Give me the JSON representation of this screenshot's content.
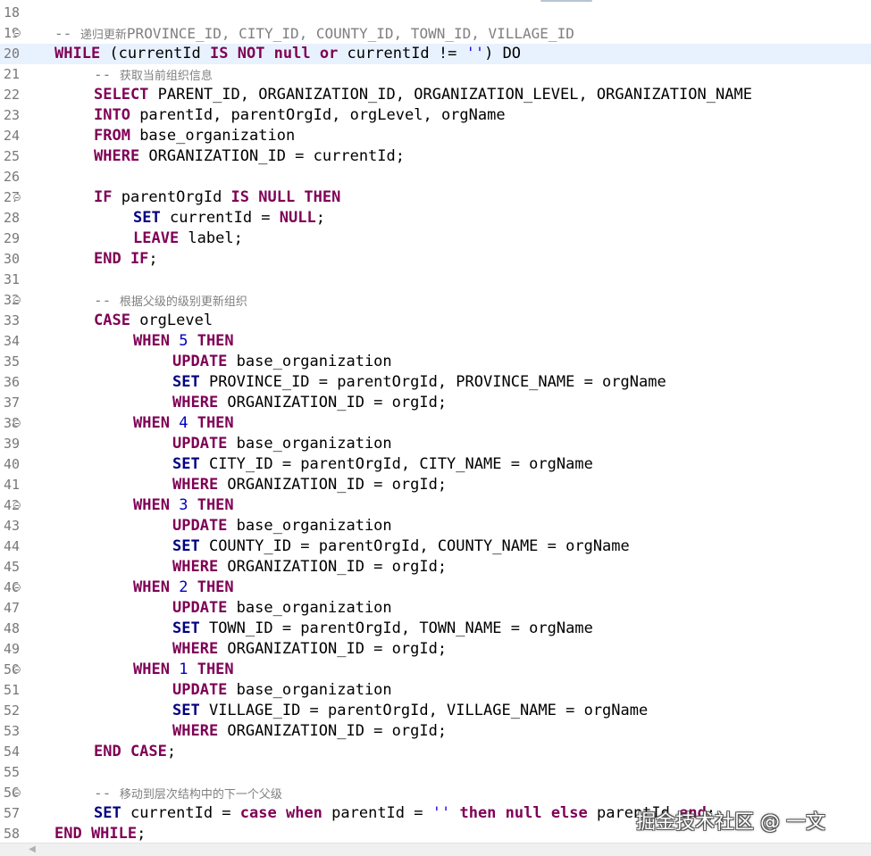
{
  "editor": {
    "current_line": "20",
    "lines": [
      {
        "num": "18",
        "fold": false,
        "indent": 0,
        "tokens": []
      },
      {
        "num": "19",
        "fold": true,
        "indent": 1,
        "tokens": [
          {
            "t": "cmt",
            "v": "-- "
          },
          {
            "t": "cmtcjk",
            "v": "递归更新"
          },
          {
            "t": "cmt",
            "v": "PROVINCE_ID, CITY_ID, COUNTY_ID, TOWN_ID, VILLAGE_ID"
          }
        ]
      },
      {
        "num": "20",
        "fold": false,
        "indent": 1,
        "tokens": [
          {
            "t": "kw",
            "v": "WHILE"
          },
          {
            "t": "txt",
            "v": " (currentId "
          },
          {
            "t": "kw",
            "v": "IS NOT null or"
          },
          {
            "t": "txt",
            "v": " currentId != "
          },
          {
            "t": "str",
            "v": "''"
          },
          {
            "t": "txt",
            "v": ") DO"
          }
        ]
      },
      {
        "num": "21",
        "fold": false,
        "indent": 2,
        "tokens": [
          {
            "t": "cmt",
            "v": "-- "
          },
          {
            "t": "cmtcjk",
            "v": "获取当前组织信息"
          }
        ]
      },
      {
        "num": "22",
        "fold": false,
        "indent": 2,
        "tokens": [
          {
            "t": "kw",
            "v": "SELECT"
          },
          {
            "t": "txt",
            "v": " PARENT_ID, ORGANIZATION_ID, ORGANIZATION_LEVEL, ORGANIZATION_NAME"
          }
        ]
      },
      {
        "num": "23",
        "fold": false,
        "indent": 2,
        "tokens": [
          {
            "t": "kw",
            "v": "INTO"
          },
          {
            "t": "txt",
            "v": " parentId, parentOrgId, orgLevel, orgName"
          }
        ]
      },
      {
        "num": "24",
        "fold": false,
        "indent": 2,
        "tokens": [
          {
            "t": "kw",
            "v": "FROM"
          },
          {
            "t": "txt",
            "v": " base_organization"
          }
        ]
      },
      {
        "num": "25",
        "fold": false,
        "indent": 2,
        "tokens": [
          {
            "t": "kw",
            "v": "WHERE"
          },
          {
            "t": "txt",
            "v": " ORGANIZATION_ID = currentId;"
          }
        ]
      },
      {
        "num": "26",
        "fold": false,
        "indent": 0,
        "tokens": []
      },
      {
        "num": "27",
        "fold": true,
        "indent": 2,
        "tokens": [
          {
            "t": "kw",
            "v": "IF"
          },
          {
            "t": "txt",
            "v": " parentOrgId "
          },
          {
            "t": "kw",
            "v": "IS NULL THEN"
          }
        ]
      },
      {
        "num": "28",
        "fold": false,
        "indent": 3,
        "tokens": [
          {
            "t": "kw2",
            "v": "SET"
          },
          {
            "t": "txt",
            "v": " currentId = "
          },
          {
            "t": "kw",
            "v": "NULL"
          },
          {
            "t": "txt",
            "v": ";"
          }
        ]
      },
      {
        "num": "29",
        "fold": false,
        "indent": 3,
        "tokens": [
          {
            "t": "kw",
            "v": "LEAVE"
          },
          {
            "t": "txt",
            "v": " label;"
          }
        ]
      },
      {
        "num": "30",
        "fold": false,
        "indent": 2,
        "tokens": [
          {
            "t": "kw",
            "v": "END IF"
          },
          {
            "t": "txt",
            "v": ";"
          }
        ]
      },
      {
        "num": "31",
        "fold": false,
        "indent": 0,
        "tokens": []
      },
      {
        "num": "32",
        "fold": true,
        "indent": 2,
        "tokens": [
          {
            "t": "cmt",
            "v": "-- "
          },
          {
            "t": "cmtcjk",
            "v": "根据父级的级别更新组织"
          }
        ]
      },
      {
        "num": "33",
        "fold": false,
        "indent": 2,
        "tokens": [
          {
            "t": "kw",
            "v": "CASE"
          },
          {
            "t": "txt",
            "v": " orgLevel"
          }
        ]
      },
      {
        "num": "34",
        "fold": false,
        "indent": 3,
        "tokens": [
          {
            "t": "kw",
            "v": "WHEN"
          },
          {
            "t": "txt",
            "v": " "
          },
          {
            "t": "num",
            "v": "5"
          },
          {
            "t": "txt",
            "v": " "
          },
          {
            "t": "kw",
            "v": "THEN"
          }
        ]
      },
      {
        "num": "35",
        "fold": false,
        "indent": 4,
        "tokens": [
          {
            "t": "kw",
            "v": "UPDATE"
          },
          {
            "t": "txt",
            "v": " base_organization"
          }
        ]
      },
      {
        "num": "36",
        "fold": false,
        "indent": 4,
        "tokens": [
          {
            "t": "kw2",
            "v": "SET"
          },
          {
            "t": "txt",
            "v": " PROVINCE_ID = parentOrgId, PROVINCE_NAME = orgName"
          }
        ]
      },
      {
        "num": "37",
        "fold": false,
        "indent": 4,
        "tokens": [
          {
            "t": "kw",
            "v": "WHERE"
          },
          {
            "t": "txt",
            "v": " ORGANIZATION_ID = orgId;"
          }
        ]
      },
      {
        "num": "38",
        "fold": true,
        "indent": 3,
        "tokens": [
          {
            "t": "kw",
            "v": "WHEN"
          },
          {
            "t": "txt",
            "v": " "
          },
          {
            "t": "num",
            "v": "4"
          },
          {
            "t": "txt",
            "v": " "
          },
          {
            "t": "kw",
            "v": "THEN"
          }
        ]
      },
      {
        "num": "39",
        "fold": false,
        "indent": 4,
        "tokens": [
          {
            "t": "kw",
            "v": "UPDATE"
          },
          {
            "t": "txt",
            "v": " base_organization"
          }
        ]
      },
      {
        "num": "40",
        "fold": false,
        "indent": 4,
        "tokens": [
          {
            "t": "kw2",
            "v": "SET"
          },
          {
            "t": "txt",
            "v": " CITY_ID = parentOrgId, CITY_NAME = orgName"
          }
        ]
      },
      {
        "num": "41",
        "fold": false,
        "indent": 4,
        "tokens": [
          {
            "t": "kw",
            "v": "WHERE"
          },
          {
            "t": "txt",
            "v": " ORGANIZATION_ID = orgId;"
          }
        ]
      },
      {
        "num": "42",
        "fold": true,
        "indent": 3,
        "tokens": [
          {
            "t": "kw",
            "v": "WHEN"
          },
          {
            "t": "txt",
            "v": " "
          },
          {
            "t": "num",
            "v": "3"
          },
          {
            "t": "txt",
            "v": " "
          },
          {
            "t": "kw",
            "v": "THEN"
          }
        ]
      },
      {
        "num": "43",
        "fold": false,
        "indent": 4,
        "tokens": [
          {
            "t": "kw",
            "v": "UPDATE"
          },
          {
            "t": "txt",
            "v": " base_organization"
          }
        ]
      },
      {
        "num": "44",
        "fold": false,
        "indent": 4,
        "tokens": [
          {
            "t": "kw2",
            "v": "SET"
          },
          {
            "t": "txt",
            "v": " COUNTY_ID = parentOrgId, COUNTY_NAME = orgName"
          }
        ]
      },
      {
        "num": "45",
        "fold": false,
        "indent": 4,
        "tokens": [
          {
            "t": "kw",
            "v": "WHERE"
          },
          {
            "t": "txt",
            "v": " ORGANIZATION_ID = orgId;"
          }
        ]
      },
      {
        "num": "46",
        "fold": true,
        "indent": 3,
        "tokens": [
          {
            "t": "kw",
            "v": "WHEN"
          },
          {
            "t": "txt",
            "v": " "
          },
          {
            "t": "num",
            "v": "2"
          },
          {
            "t": "txt",
            "v": " "
          },
          {
            "t": "kw",
            "v": "THEN"
          }
        ]
      },
      {
        "num": "47",
        "fold": false,
        "indent": 4,
        "tokens": [
          {
            "t": "kw",
            "v": "UPDATE"
          },
          {
            "t": "txt",
            "v": " base_organization"
          }
        ]
      },
      {
        "num": "48",
        "fold": false,
        "indent": 4,
        "tokens": [
          {
            "t": "kw2",
            "v": "SET"
          },
          {
            "t": "txt",
            "v": " TOWN_ID = parentOrgId, TOWN_NAME = orgName"
          }
        ]
      },
      {
        "num": "49",
        "fold": false,
        "indent": 4,
        "tokens": [
          {
            "t": "kw",
            "v": "WHERE"
          },
          {
            "t": "txt",
            "v": " ORGANIZATION_ID = orgId;"
          }
        ]
      },
      {
        "num": "50",
        "fold": true,
        "indent": 3,
        "tokens": [
          {
            "t": "kw",
            "v": "WHEN"
          },
          {
            "t": "txt",
            "v": " "
          },
          {
            "t": "num",
            "v": "1"
          },
          {
            "t": "txt",
            "v": " "
          },
          {
            "t": "kw",
            "v": "THEN"
          }
        ]
      },
      {
        "num": "51",
        "fold": false,
        "indent": 4,
        "tokens": [
          {
            "t": "kw",
            "v": "UPDATE"
          },
          {
            "t": "txt",
            "v": " base_organization"
          }
        ]
      },
      {
        "num": "52",
        "fold": false,
        "indent": 4,
        "tokens": [
          {
            "t": "kw2",
            "v": "SET"
          },
          {
            "t": "txt",
            "v": " VILLAGE_ID = parentOrgId, VILLAGE_NAME = orgName"
          }
        ]
      },
      {
        "num": "53",
        "fold": false,
        "indent": 4,
        "tokens": [
          {
            "t": "kw",
            "v": "WHERE"
          },
          {
            "t": "txt",
            "v": " ORGANIZATION_ID = orgId;"
          }
        ]
      },
      {
        "num": "54",
        "fold": false,
        "indent": 2,
        "tokens": [
          {
            "t": "kw",
            "v": "END CASE"
          },
          {
            "t": "txt",
            "v": ";"
          }
        ]
      },
      {
        "num": "55",
        "fold": false,
        "indent": 0,
        "tokens": []
      },
      {
        "num": "56",
        "fold": true,
        "indent": 2,
        "tokens": [
          {
            "t": "cmt",
            "v": "-- "
          },
          {
            "t": "cmtcjk",
            "v": "移动到层次结构中的下一个父级"
          }
        ]
      },
      {
        "num": "57",
        "fold": false,
        "indent": 2,
        "tokens": [
          {
            "t": "kw2",
            "v": "SET"
          },
          {
            "t": "txt",
            "v": " currentId = "
          },
          {
            "t": "kw",
            "v": "case when"
          },
          {
            "t": "txt",
            "v": " parentId = "
          },
          {
            "t": "str",
            "v": "''"
          },
          {
            "t": "txt",
            "v": " "
          },
          {
            "t": "kw",
            "v": "then null else"
          },
          {
            "t": "txt",
            "v": " parentId "
          },
          {
            "t": "kw",
            "v": "end"
          },
          {
            "t": "txt",
            "v": ";"
          }
        ]
      },
      {
        "num": "58",
        "fold": false,
        "indent": 1,
        "tokens": [
          {
            "t": "kw",
            "v": "END WHILE"
          },
          {
            "t": "txt",
            "v": ";"
          }
        ]
      }
    ]
  },
  "watermark": {
    "text": "掘金技术社区 @ 一文"
  },
  "scrollbar": {
    "left_arrow": "◀"
  },
  "colors": {
    "keyword": "#7f0055",
    "keyword_set": "#000080",
    "number": "#0000c0",
    "string": "#2a00ff",
    "comment": "#808080",
    "current_line_bg": "#e8f2fe"
  }
}
